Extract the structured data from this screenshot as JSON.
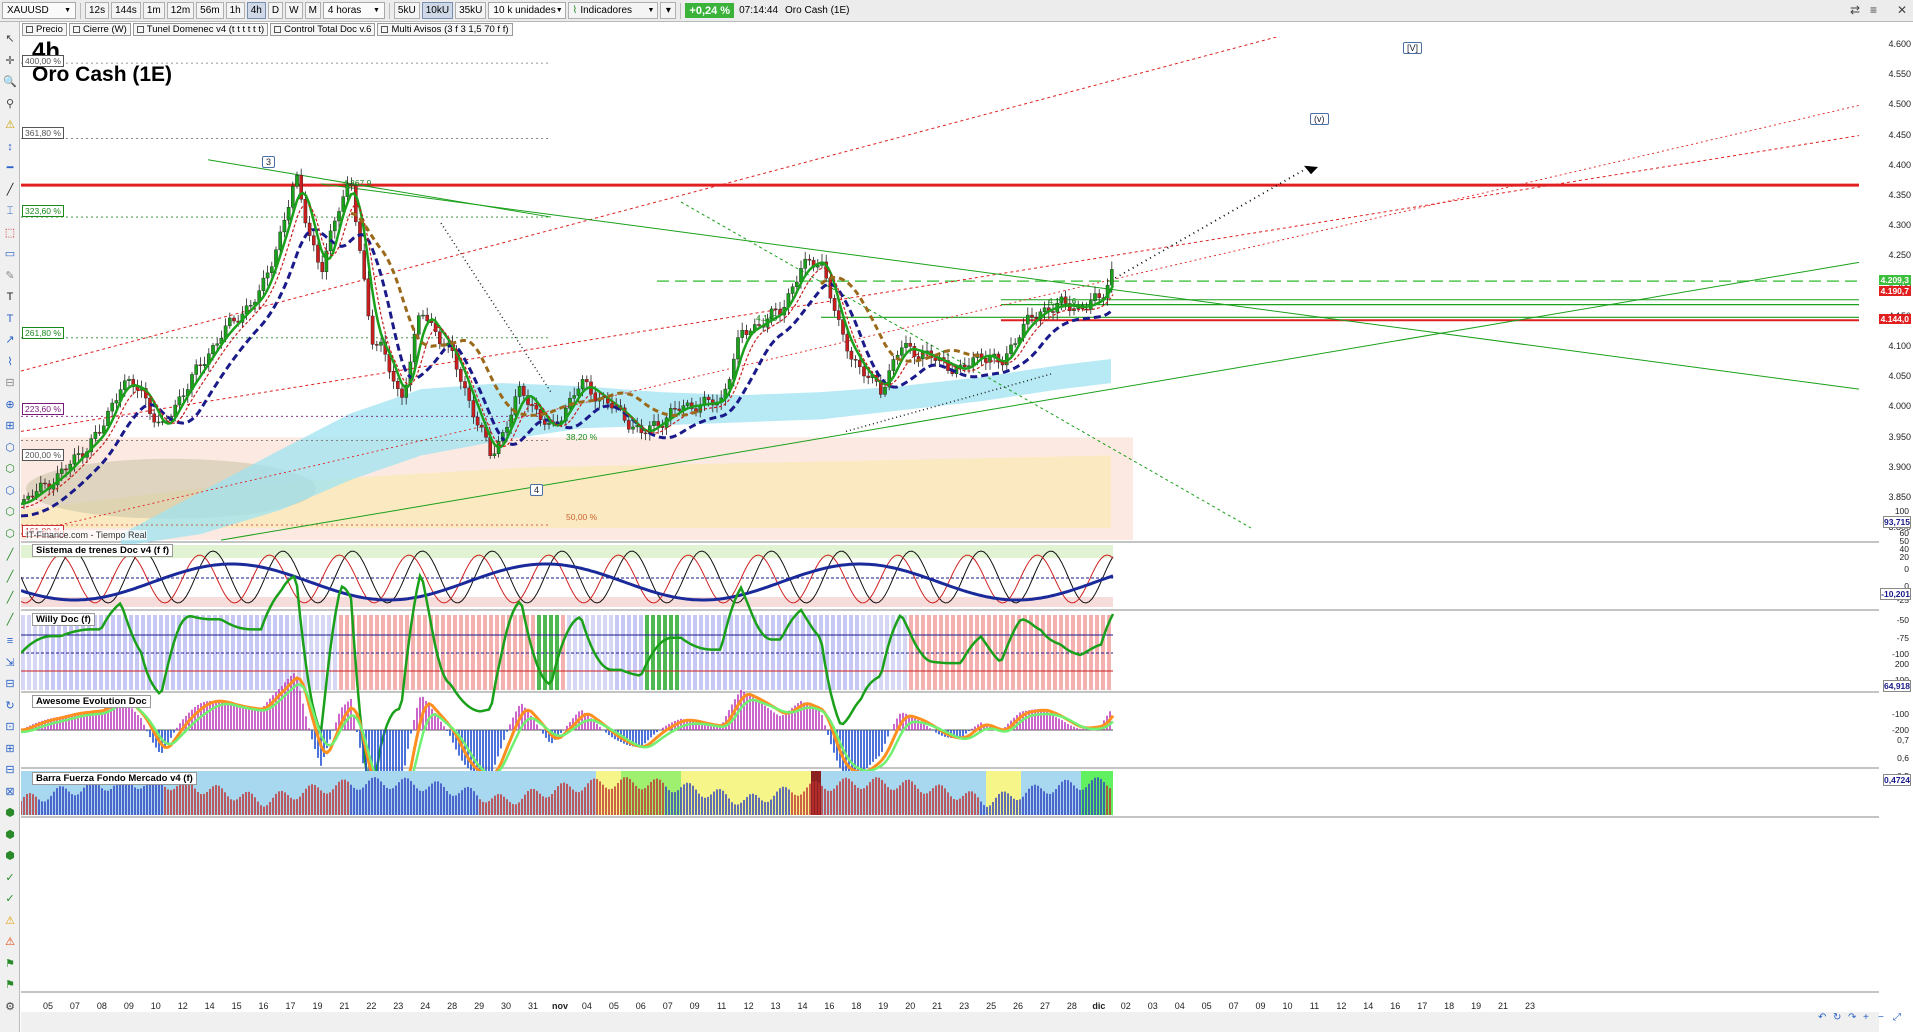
{
  "toolbar": {
    "symbol": "XAUUSD",
    "intervals": [
      "12s",
      "144s",
      "1m",
      "12m",
      "56m",
      "1h",
      "4h",
      "D",
      "W",
      "M"
    ],
    "active_interval": "4h",
    "period_select": "4 horas",
    "volumes": [
      "5kU",
      "10kU",
      "35kU"
    ],
    "active_volume": "10kU",
    "units_select": "10 k unidades",
    "indicators_label": "Indicadores",
    "change": "+0,24 %",
    "time": "07:14:44",
    "instrument_name": "Oro Cash (1E)"
  },
  "tags": [
    {
      "label": "Precio"
    },
    {
      "label": "Cierre (W)"
    },
    {
      "label": "Tunel Domenec v4 (t t t t t t)"
    },
    {
      "label": "Control Total Doc v.6"
    },
    {
      "label": "Multi Avisos (3 f 3 1,5 70 f f)"
    }
  ],
  "chart": {
    "timeframe": "4h",
    "name": "Oro Cash (1E)",
    "watermark": "IT-Finance.com - Tiempo Real",
    "price_ticks": [
      "4.600",
      "4.550",
      "4.500",
      "4.450",
      "4.400",
      "4.350",
      "4.300",
      "4.250",
      "4.200",
      "4.150",
      "4.100",
      "4.050",
      "4.000",
      "3.950",
      "3.900",
      "3.850",
      "3.800"
    ],
    "price_labels": {
      "last": "4.209,3",
      "resistance": "4.190,7",
      "support": "4.144,0"
    },
    "fib_levels": [
      {
        "label": "400,00 %",
        "color": "#555555"
      },
      {
        "label": "361,80 %",
        "color": "#555555"
      },
      {
        "label": "323,60 %",
        "color": "#1a8a1a"
      },
      {
        "label": "261,80 %",
        "color": "#1a8a1a"
      },
      {
        "label": "223,60 %",
        "color": "#7a1a7a"
      },
      {
        "label": "200,00 %",
        "color": "#555555"
      },
      {
        "label": "161,80 %",
        "color": "#cc3333"
      }
    ],
    "annotations": {
      "high": "4.367,9",
      "mid1": "4.143",
      "mid2": "4.171,6",
      "retr1": "38,20 %",
      "retr2": "50,00 %"
    },
    "waves": [
      "3",
      "4",
      "(v)",
      "[V]"
    ],
    "dates": [
      "05",
      "07",
      "08",
      "09",
      "10",
      "12",
      "14",
      "15",
      "16",
      "17",
      "19",
      "21",
      "22",
      "23",
      "24",
      "28",
      "29",
      "30",
      "31",
      "nov",
      "04",
      "05",
      "06",
      "07",
      "09",
      "11",
      "12",
      "13",
      "14",
      "16",
      "18",
      "19",
      "20",
      "21",
      "23",
      "25",
      "26",
      "27",
      "28",
      "dic",
      "02",
      "03",
      "04",
      "05",
      "07",
      "09",
      "10",
      "11",
      "12",
      "14",
      "16",
      "17",
      "18",
      "19",
      "21",
      "23"
    ]
  },
  "panels": [
    {
      "title": "Sistema de trenes Doc v4 (f f)",
      "value": "93,715",
      "ticks": [
        "100",
        "80",
        "60",
        "50",
        "40",
        "20",
        "0"
      ]
    },
    {
      "title": "Willy Doc (f)",
      "value": "-10,201",
      "ticks": [
        "0",
        "-25",
        "-50",
        "-75",
        "-100"
      ]
    },
    {
      "title": "Awesome Evolution Doc",
      "value": "64,918",
      "ticks": [
        "200",
        "100",
        "-100",
        "-200"
      ]
    },
    {
      "title": "Barra Fuerza Fondo Mercado v4 (f)",
      "value": "0,4724",
      "ticks": [
        "0,7",
        "0,6",
        "0,5"
      ]
    }
  ],
  "colors": {
    "resistance": "#e02020",
    "support_green": "#1aa01a",
    "bull": "#1aa01a",
    "bear": "#c81e1e",
    "navy": "#1a1a8a"
  }
}
